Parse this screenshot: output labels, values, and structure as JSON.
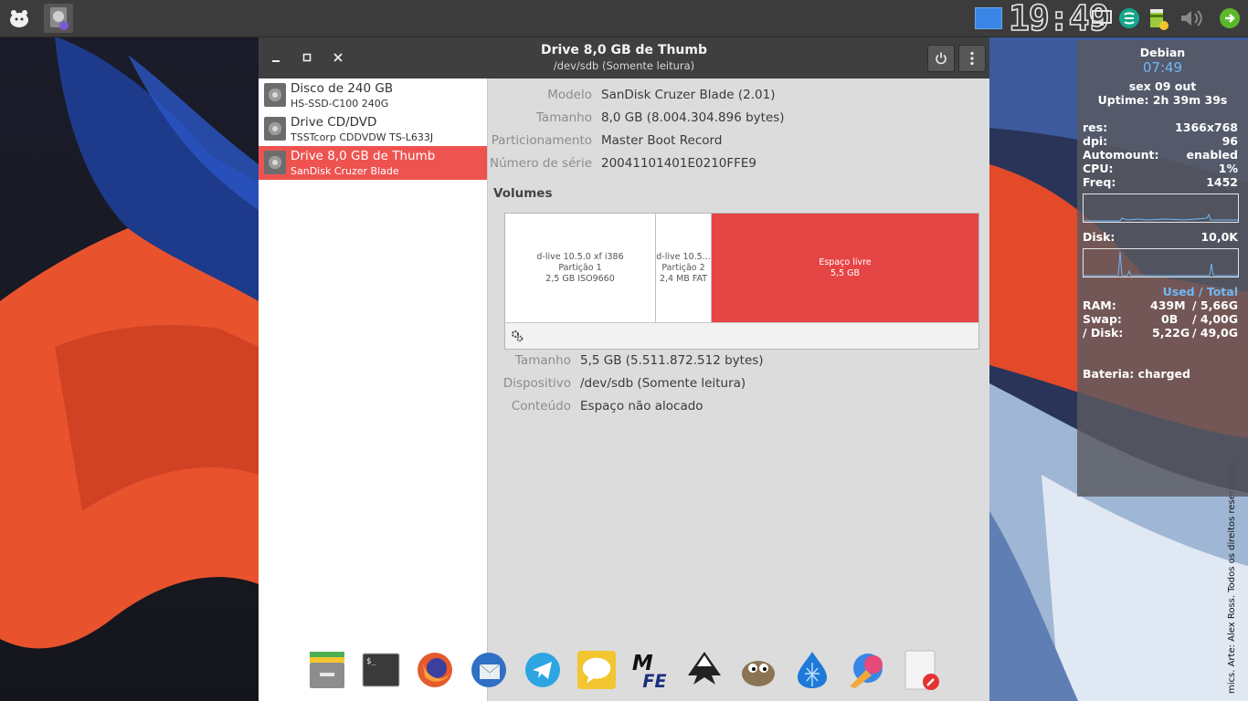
{
  "window": {
    "title": "Drive 8,0 GB de Thumb",
    "subtitle": "/dev/sdb (Somente leitura)"
  },
  "drives": [
    {
      "name": "Disco de 240 GB",
      "model": "HS-SSD-C100 240G",
      "selected": false
    },
    {
      "name": "Drive CD/DVD",
      "model": "TSSTcorp CDDVDW TS-L633J",
      "selected": false
    },
    {
      "name": "Drive 8,0 GB de Thumb",
      "model": "SanDisk Cruzer Blade",
      "selected": true
    }
  ],
  "drive_props": [
    {
      "label": "Modelo",
      "value": "SanDisk Cruzer Blade (2.01)"
    },
    {
      "label": "Tamanho",
      "value": "8,0 GB (8.004.304.896 bytes)"
    },
    {
      "label": "Particionamento",
      "value": "Master Boot Record"
    },
    {
      "label": "Número de série",
      "value": "20041101401E0210FFE9"
    }
  ],
  "volumes_heading": "Volumes",
  "volumes": [
    {
      "line1": "d-live 10.5.0 xf i386",
      "line2": "Partição 1",
      "line3": "2,5 GB ISO9660"
    },
    {
      "line1": "d-live 10.5...",
      "line2": "Partição 2",
      "line3": "2,4 MB FAT"
    },
    {
      "line1": "Espaço livre",
      "line2": "5,5 GB",
      "line3": ""
    }
  ],
  "volume_props": [
    {
      "label": "Tamanho",
      "value": "5,5 GB (5.511.872.512 bytes)"
    },
    {
      "label": "Dispositivo",
      "value": "/dev/sdb (Somente leitura)"
    },
    {
      "label": "Conteúdo",
      "value": "Espaço não alocado"
    }
  ],
  "panel": {
    "clock": "19:49"
  },
  "conky": {
    "host": "Debian",
    "time": "07:49",
    "date": "sex 09 out",
    "uptime": "Uptime: 2h 39m 39s",
    "rows": [
      {
        "k": "res:",
        "v": "1366x768"
      },
      {
        "k": "dpi:",
        "v": "96"
      },
      {
        "k": "Automount:",
        "v": "enabled"
      },
      {
        "k": "CPU:",
        "v": "1%"
      },
      {
        "k": "Freq:",
        "v": "1452"
      }
    ],
    "disk": {
      "k": "Disk:",
      "v": "10,0K"
    },
    "used_total": "Used / Total",
    "mem": [
      {
        "k": "RAM:",
        "used": "439M",
        "total": "/ 5,66G"
      },
      {
        "k": "Swap:",
        "used": "0B",
        "total": "/ 4,00G"
      },
      {
        "k": "/ Disk:",
        "used": "5,22G",
        "total": "/ 49,0G"
      }
    ],
    "battery_label": "Bateria:",
    "battery_value": "charged"
  },
  "wallpaper_credit": "mics. Arte: Alex Ross. Todos os direitos reservados.",
  "colors": {
    "accent": "#ee5350",
    "headerbar": "#3f3f3f",
    "panel": "#3c3c3c"
  }
}
